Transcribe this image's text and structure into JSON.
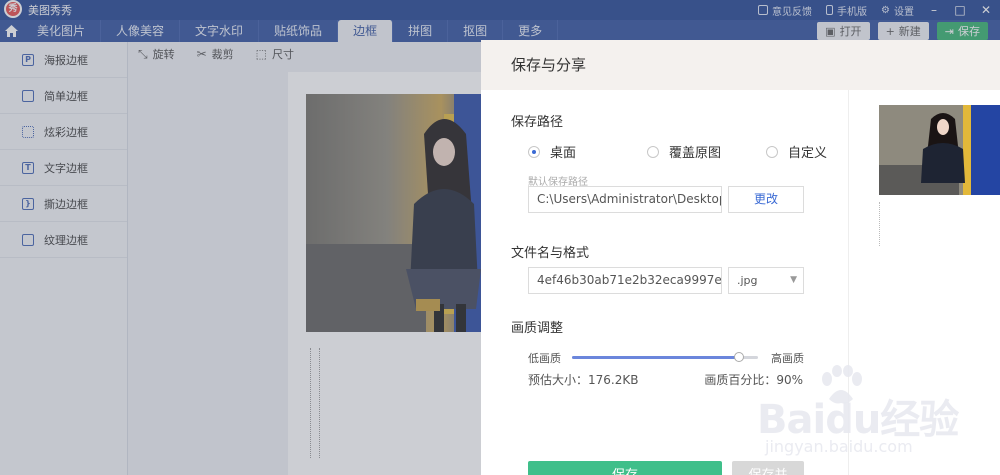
{
  "app": {
    "logo_text": "秀",
    "title": "美图秀秀"
  },
  "titlebar": {
    "feedback": "意见反馈",
    "mobile": "手机版",
    "settings": "设置"
  },
  "nav": {
    "tabs": [
      {
        "label": "美化图片"
      },
      {
        "label": "人像美容"
      },
      {
        "label": "文字水印"
      },
      {
        "label": "贴纸饰品"
      },
      {
        "label": "边框"
      },
      {
        "label": "拼图"
      },
      {
        "label": "抠图"
      },
      {
        "label": "更多"
      }
    ],
    "active_tab": "边框",
    "open_label": "打开",
    "new_label": "新建",
    "save_label": "保存"
  },
  "sidebar": {
    "items": [
      {
        "label": "海报边框",
        "icon": "P"
      },
      {
        "label": "简单边框",
        "icon": "□"
      },
      {
        "label": "炫彩边框",
        "icon": "▫"
      },
      {
        "label": "文字边框",
        "icon": "T"
      },
      {
        "label": "撕边边框",
        "icon": "}"
      },
      {
        "label": "纹理边框",
        "icon": "▦"
      }
    ]
  },
  "toolbar": {
    "rotate": "旋转",
    "crop": "裁剪",
    "size": "尺寸"
  },
  "dialog": {
    "title": "保存与分享",
    "save_path_title": "保存路径",
    "radio_desktop": "桌面",
    "radio_overwrite": "覆盖原图",
    "radio_custom": "自定义",
    "selected_radio": "桌面",
    "default_path_hint": "默认保存路径",
    "path_value": "C:\\Users\\Administrator\\Desktop",
    "change_button": "更改",
    "filename_title": "文件名与格式",
    "filename_value": "4ef46b30ab71e2b32eca9997e...",
    "format_value": ".jpg",
    "quality_title": "画质调整",
    "quality_low": "低画质",
    "quality_high": "高画质",
    "quality_percent": 90,
    "estimated_size": "预估大小：176.2KB",
    "quality_percent_label": "画质百分比：90%",
    "save_button": "保存",
    "share_button": "保存并"
  },
  "watermark": {
    "brand": "Baidu经验",
    "url": "jingyan.baidu.com"
  },
  "colors": {
    "titlebar": "#1d3f8f",
    "navbar": "#2a4c9c",
    "accent": "#3a6ad4",
    "save_green": "#3fbf8a"
  }
}
